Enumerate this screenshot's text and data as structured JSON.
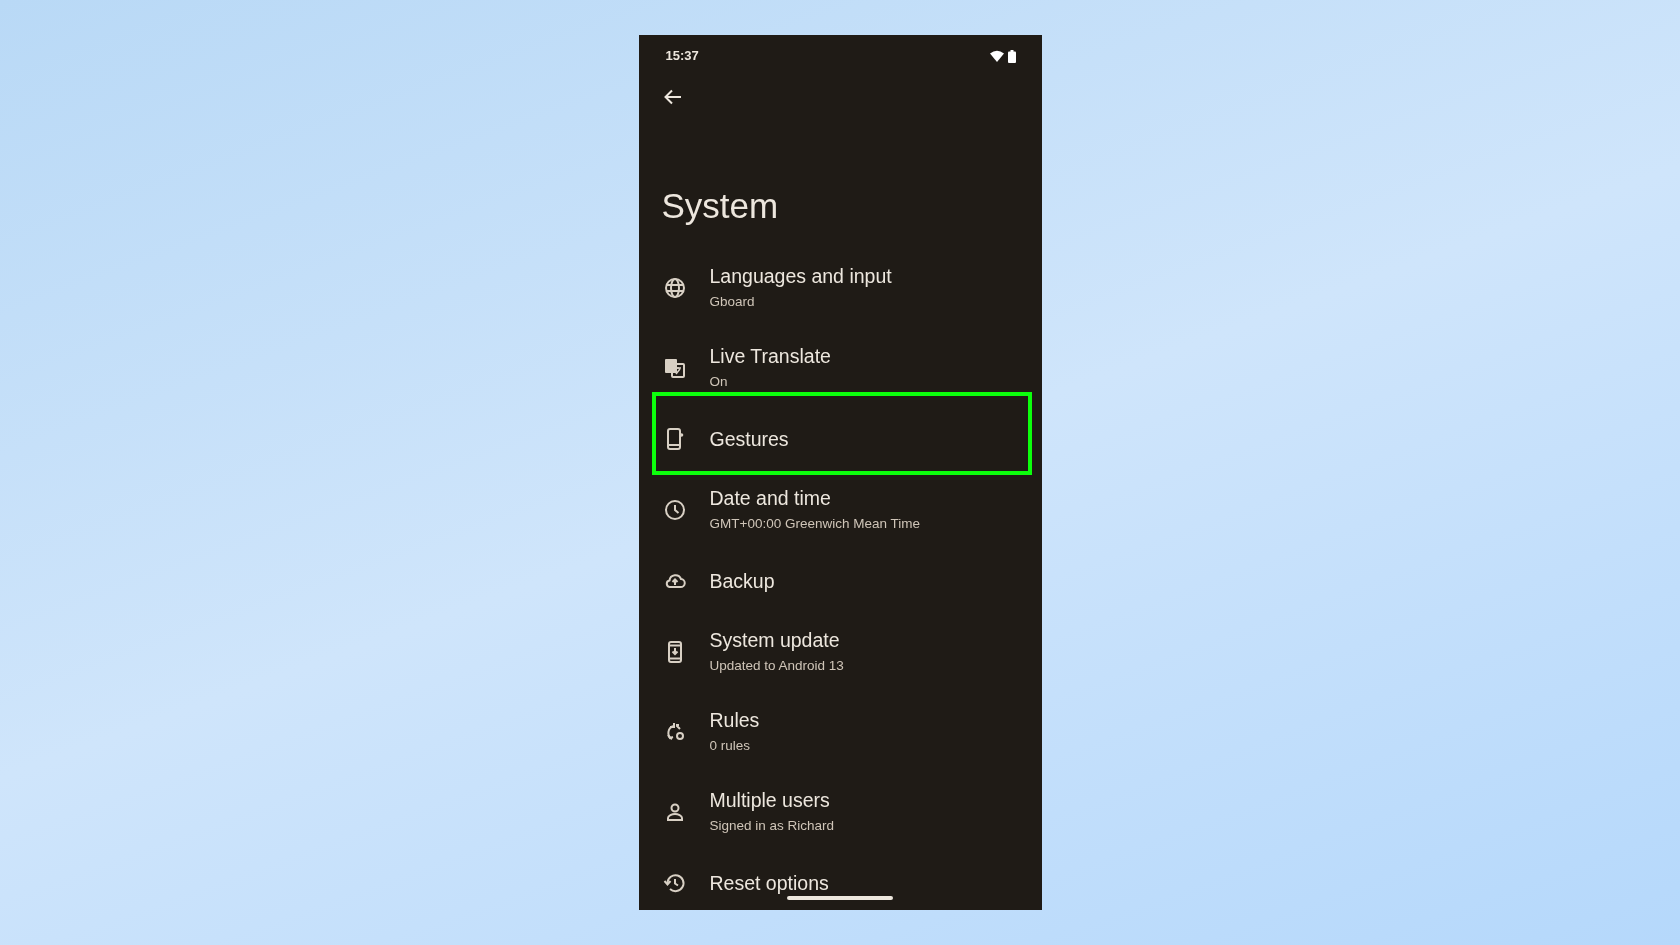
{
  "status_bar": {
    "time": "15:37"
  },
  "title": "System",
  "items": [
    {
      "title": "Languages and input",
      "subtitle": "Gboard",
      "highlighted": false
    },
    {
      "title": "Live Translate",
      "subtitle": "On",
      "highlighted": false
    },
    {
      "title": "Gestures",
      "highlighted": true
    },
    {
      "title": "Date and time",
      "subtitle": "GMT+00:00 Greenwich Mean Time",
      "highlighted": false
    },
    {
      "title": "Backup",
      "highlighted": false
    },
    {
      "title": "System update",
      "subtitle": "Updated to Android 13",
      "highlighted": false
    },
    {
      "title": "Rules",
      "subtitle": "0 rules",
      "highlighted": false
    },
    {
      "title": "Multiple users",
      "subtitle": "Signed in as Richard",
      "highlighted": false
    },
    {
      "title": "Reset options",
      "highlighted": false
    }
  ]
}
